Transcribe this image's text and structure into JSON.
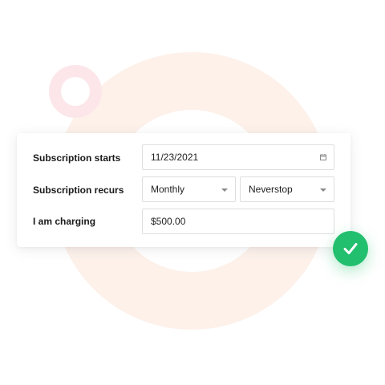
{
  "form": {
    "start": {
      "label": "Subscription starts",
      "value": "11/23/2021",
      "icon": "calendar-icon"
    },
    "recurs": {
      "label": "Subscription recurs",
      "frequency": "Monthly",
      "duration": "Neverstop",
      "icon": "chevron-down-icon"
    },
    "charging": {
      "label": "I am charging",
      "value": "$500.00"
    }
  },
  "status": {
    "icon": "checkmark-icon",
    "color": "#22bf6e"
  },
  "decor": {
    "ring_color": "#fdf1ea",
    "small_ring_color": "#fce6ea"
  }
}
